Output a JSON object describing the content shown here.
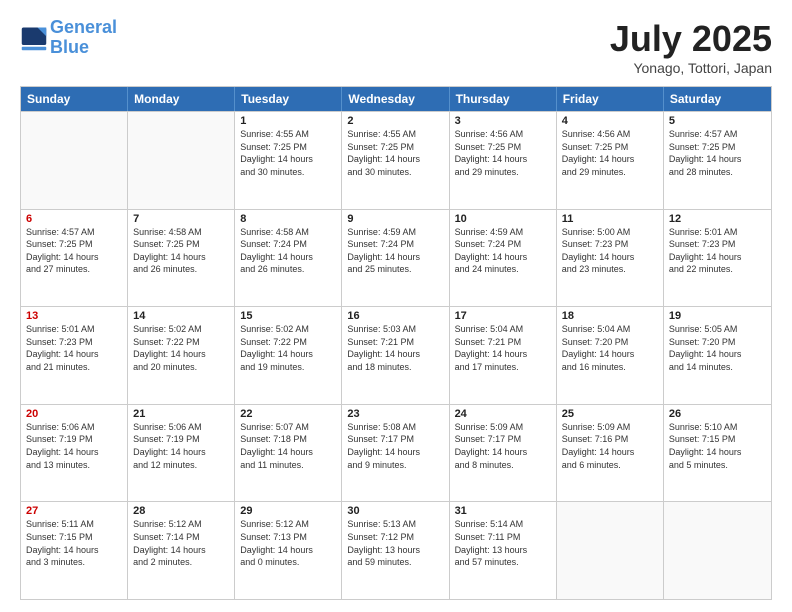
{
  "header": {
    "logo_line1": "General",
    "logo_line2": "Blue",
    "month": "July 2025",
    "location": "Yonago, Tottori, Japan"
  },
  "weekdays": [
    "Sunday",
    "Monday",
    "Tuesday",
    "Wednesday",
    "Thursday",
    "Friday",
    "Saturday"
  ],
  "weeks": [
    [
      {
        "day": "",
        "lines": []
      },
      {
        "day": "",
        "lines": []
      },
      {
        "day": "1",
        "lines": [
          "Sunrise: 4:55 AM",
          "Sunset: 7:25 PM",
          "Daylight: 14 hours",
          "and 30 minutes."
        ]
      },
      {
        "day": "2",
        "lines": [
          "Sunrise: 4:55 AM",
          "Sunset: 7:25 PM",
          "Daylight: 14 hours",
          "and 30 minutes."
        ]
      },
      {
        "day": "3",
        "lines": [
          "Sunrise: 4:56 AM",
          "Sunset: 7:25 PM",
          "Daylight: 14 hours",
          "and 29 minutes."
        ]
      },
      {
        "day": "4",
        "lines": [
          "Sunrise: 4:56 AM",
          "Sunset: 7:25 PM",
          "Daylight: 14 hours",
          "and 29 minutes."
        ]
      },
      {
        "day": "5",
        "lines": [
          "Sunrise: 4:57 AM",
          "Sunset: 7:25 PM",
          "Daylight: 14 hours",
          "and 28 minutes."
        ]
      }
    ],
    [
      {
        "day": "6",
        "lines": [
          "Sunrise: 4:57 AM",
          "Sunset: 7:25 PM",
          "Daylight: 14 hours",
          "and 27 minutes."
        ]
      },
      {
        "day": "7",
        "lines": [
          "Sunrise: 4:58 AM",
          "Sunset: 7:25 PM",
          "Daylight: 14 hours",
          "and 26 minutes."
        ]
      },
      {
        "day": "8",
        "lines": [
          "Sunrise: 4:58 AM",
          "Sunset: 7:24 PM",
          "Daylight: 14 hours",
          "and 26 minutes."
        ]
      },
      {
        "day": "9",
        "lines": [
          "Sunrise: 4:59 AM",
          "Sunset: 7:24 PM",
          "Daylight: 14 hours",
          "and 25 minutes."
        ]
      },
      {
        "day": "10",
        "lines": [
          "Sunrise: 4:59 AM",
          "Sunset: 7:24 PM",
          "Daylight: 14 hours",
          "and 24 minutes."
        ]
      },
      {
        "day": "11",
        "lines": [
          "Sunrise: 5:00 AM",
          "Sunset: 7:23 PM",
          "Daylight: 14 hours",
          "and 23 minutes."
        ]
      },
      {
        "day": "12",
        "lines": [
          "Sunrise: 5:01 AM",
          "Sunset: 7:23 PM",
          "Daylight: 14 hours",
          "and 22 minutes."
        ]
      }
    ],
    [
      {
        "day": "13",
        "lines": [
          "Sunrise: 5:01 AM",
          "Sunset: 7:23 PM",
          "Daylight: 14 hours",
          "and 21 minutes."
        ]
      },
      {
        "day": "14",
        "lines": [
          "Sunrise: 5:02 AM",
          "Sunset: 7:22 PM",
          "Daylight: 14 hours",
          "and 20 minutes."
        ]
      },
      {
        "day": "15",
        "lines": [
          "Sunrise: 5:02 AM",
          "Sunset: 7:22 PM",
          "Daylight: 14 hours",
          "and 19 minutes."
        ]
      },
      {
        "day": "16",
        "lines": [
          "Sunrise: 5:03 AM",
          "Sunset: 7:21 PM",
          "Daylight: 14 hours",
          "and 18 minutes."
        ]
      },
      {
        "day": "17",
        "lines": [
          "Sunrise: 5:04 AM",
          "Sunset: 7:21 PM",
          "Daylight: 14 hours",
          "and 17 minutes."
        ]
      },
      {
        "day": "18",
        "lines": [
          "Sunrise: 5:04 AM",
          "Sunset: 7:20 PM",
          "Daylight: 14 hours",
          "and 16 minutes."
        ]
      },
      {
        "day": "19",
        "lines": [
          "Sunrise: 5:05 AM",
          "Sunset: 7:20 PM",
          "Daylight: 14 hours",
          "and 14 minutes."
        ]
      }
    ],
    [
      {
        "day": "20",
        "lines": [
          "Sunrise: 5:06 AM",
          "Sunset: 7:19 PM",
          "Daylight: 14 hours",
          "and 13 minutes."
        ]
      },
      {
        "day": "21",
        "lines": [
          "Sunrise: 5:06 AM",
          "Sunset: 7:19 PM",
          "Daylight: 14 hours",
          "and 12 minutes."
        ]
      },
      {
        "day": "22",
        "lines": [
          "Sunrise: 5:07 AM",
          "Sunset: 7:18 PM",
          "Daylight: 14 hours",
          "and 11 minutes."
        ]
      },
      {
        "day": "23",
        "lines": [
          "Sunrise: 5:08 AM",
          "Sunset: 7:17 PM",
          "Daylight: 14 hours",
          "and 9 minutes."
        ]
      },
      {
        "day": "24",
        "lines": [
          "Sunrise: 5:09 AM",
          "Sunset: 7:17 PM",
          "Daylight: 14 hours",
          "and 8 minutes."
        ]
      },
      {
        "day": "25",
        "lines": [
          "Sunrise: 5:09 AM",
          "Sunset: 7:16 PM",
          "Daylight: 14 hours",
          "and 6 minutes."
        ]
      },
      {
        "day": "26",
        "lines": [
          "Sunrise: 5:10 AM",
          "Sunset: 7:15 PM",
          "Daylight: 14 hours",
          "and 5 minutes."
        ]
      }
    ],
    [
      {
        "day": "27",
        "lines": [
          "Sunrise: 5:11 AM",
          "Sunset: 7:15 PM",
          "Daylight: 14 hours",
          "and 3 minutes."
        ]
      },
      {
        "day": "28",
        "lines": [
          "Sunrise: 5:12 AM",
          "Sunset: 7:14 PM",
          "Daylight: 14 hours",
          "and 2 minutes."
        ]
      },
      {
        "day": "29",
        "lines": [
          "Sunrise: 5:12 AM",
          "Sunset: 7:13 PM",
          "Daylight: 14 hours",
          "and 0 minutes."
        ]
      },
      {
        "day": "30",
        "lines": [
          "Sunrise: 5:13 AM",
          "Sunset: 7:12 PM",
          "Daylight: 13 hours",
          "and 59 minutes."
        ]
      },
      {
        "day": "31",
        "lines": [
          "Sunrise: 5:14 AM",
          "Sunset: 7:11 PM",
          "Daylight: 13 hours",
          "and 57 minutes."
        ]
      },
      {
        "day": "",
        "lines": []
      },
      {
        "day": "",
        "lines": []
      }
    ]
  ]
}
